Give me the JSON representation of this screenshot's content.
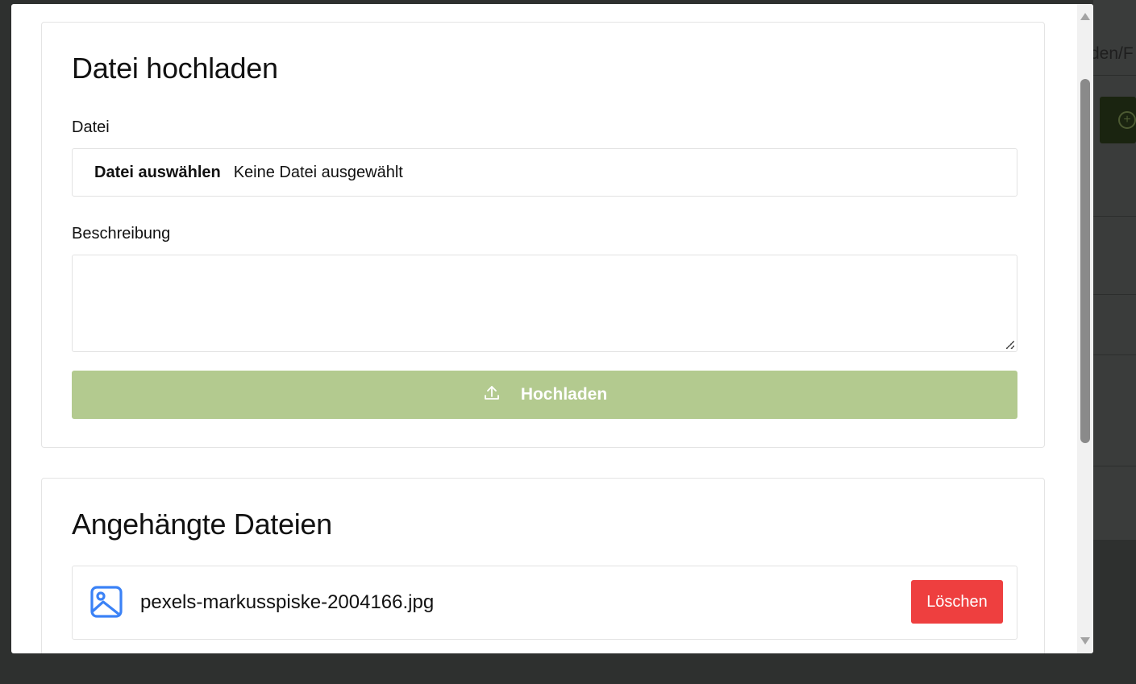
{
  "background": {
    "breadcrumb_fragment": "den/F"
  },
  "modal": {
    "upload_card": {
      "title": "Datei hochladen",
      "file_label": "Datei",
      "file_choose_label": "Datei auswählen",
      "file_status": "Keine Datei ausgewählt",
      "description_label": "Beschreibung",
      "description_value": "",
      "upload_button_label": "Hochladen",
      "upload_button_color": "#b3ca8f",
      "upload_icon": "upload-icon"
    },
    "files_card": {
      "title": "Angehängte Dateien",
      "files": [
        {
          "icon": "image-icon",
          "name": "pexels-markusspiske-2004166.jpg",
          "delete_label": "Löschen",
          "delete_color": "#ee3f3f"
        }
      ]
    }
  }
}
